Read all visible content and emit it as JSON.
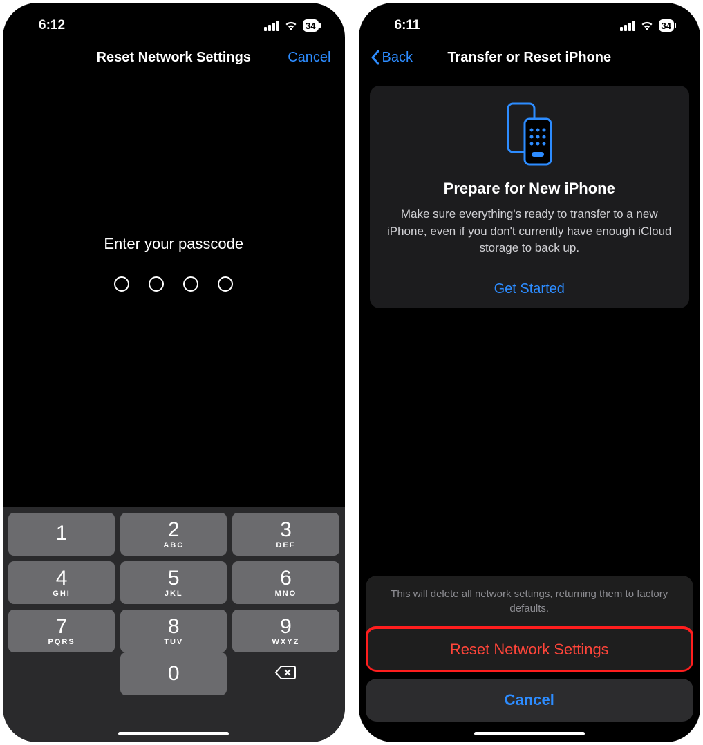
{
  "left": {
    "status": {
      "time": "6:12",
      "battery": "34"
    },
    "nav": {
      "title": "Reset Network Settings",
      "cancel": "Cancel"
    },
    "passcode": {
      "prompt": "Enter your passcode"
    },
    "keypad": [
      {
        "digit": "1",
        "letters": ""
      },
      {
        "digit": "2",
        "letters": "ABC"
      },
      {
        "digit": "3",
        "letters": "DEF"
      },
      {
        "digit": "4",
        "letters": "GHI"
      },
      {
        "digit": "5",
        "letters": "JKL"
      },
      {
        "digit": "6",
        "letters": "MNO"
      },
      {
        "digit": "7",
        "letters": "PQRS"
      },
      {
        "digit": "8",
        "letters": "TUV"
      },
      {
        "digit": "9",
        "letters": "WXYZ"
      }
    ],
    "zero": {
      "digit": "0",
      "letters": ""
    }
  },
  "right": {
    "status": {
      "time": "6:11",
      "battery": "34"
    },
    "nav": {
      "back": "Back",
      "title": "Transfer or Reset iPhone"
    },
    "card": {
      "title": "Prepare for New iPhone",
      "desc": "Make sure everything's ready to transfer to a new iPhone, even if you don't currently have enough iCloud storage to back up.",
      "cta": "Get Started"
    },
    "sheet": {
      "msg": "This will delete all network settings, returning them to factory defaults.",
      "action": "Reset Network Settings",
      "cancel": "Cancel"
    }
  }
}
